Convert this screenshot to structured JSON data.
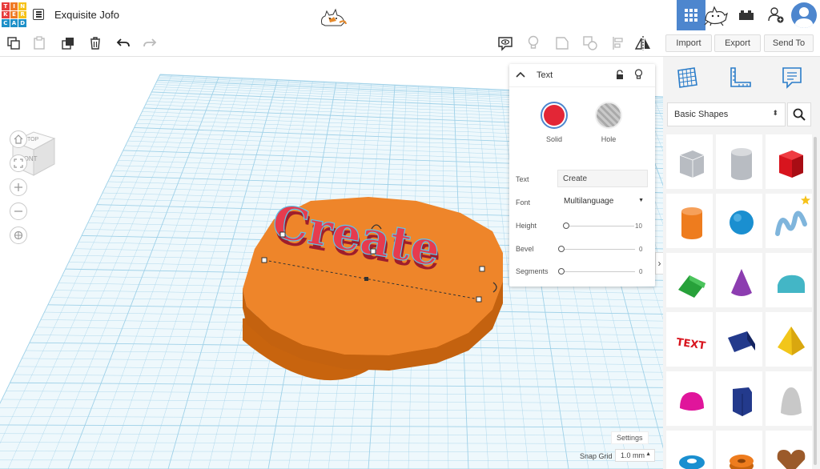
{
  "header": {
    "logo_letters": [
      "T",
      "I",
      "N",
      "K",
      "E",
      "R",
      "C",
      "A",
      "D"
    ],
    "design_title": "Exquisite Jofo"
  },
  "toolbar": {
    "buttons": [
      "copy",
      "paste",
      "duplicate",
      "delete",
      "undo",
      "redo",
      "note",
      "light-bulb",
      "group",
      "ungroup",
      "align",
      "mirror"
    ]
  },
  "actions": {
    "import_label": "Import",
    "export_label": "Export",
    "send_to_label": "Send To"
  },
  "view_cube": {
    "top_label": "TOP",
    "front_label": "FRONT"
  },
  "inspector": {
    "title": "Text",
    "solid_label": "Solid",
    "hole_label": "Hole",
    "solid_color": "#e32636",
    "text_label": "Text",
    "text_value": "Create",
    "font_label": "Font",
    "font_value": "Multilanguage",
    "height_label": "Height",
    "height_value": "10",
    "bevel_label": "Bevel",
    "bevel_value": "0",
    "segments_label": "Segments",
    "segments_value": "0"
  },
  "scene": {
    "text_object": "Create",
    "plate_color": "#f08a24",
    "text_color": "#e63b4e"
  },
  "workplane": {
    "settings_label": "Settings",
    "snap_grid_label": "Snap Grid",
    "snap_grid_value": "1.0 mm"
  },
  "shape_panel": {
    "category": "Basic Shapes",
    "shapes": [
      {
        "name": "box-hole",
        "color": "#b8bcc2"
      },
      {
        "name": "cylinder-hole",
        "color": "#b8bcc2"
      },
      {
        "name": "box",
        "color": "#d8141e"
      },
      {
        "name": "cylinder",
        "color": "#ee7c1e"
      },
      {
        "name": "sphere",
        "color": "#1a8fd0"
      },
      {
        "name": "scribble",
        "color": "#7fb5dc"
      },
      {
        "name": "roof",
        "color": "#27a13a"
      },
      {
        "name": "cone",
        "color": "#8c3db0"
      },
      {
        "name": "round-roof",
        "color": "#43b6c6"
      },
      {
        "name": "text",
        "color": "#d8141e"
      },
      {
        "name": "wedge",
        "color": "#233a8c"
      },
      {
        "name": "pyramid",
        "color": "#f2c61a"
      },
      {
        "name": "half-sphere",
        "color": "#e0159b"
      },
      {
        "name": "polygon",
        "color": "#233a8c"
      },
      {
        "name": "paraboloid",
        "color": "#c8c8c8"
      },
      {
        "name": "torus",
        "color": "#1a8fd0"
      },
      {
        "name": "tube",
        "color": "#ee7c1e"
      },
      {
        "name": "heart",
        "color": "#9b5a2a"
      }
    ]
  },
  "colors": {
    "accent": "#4d86ce",
    "grid": "#bfe1f0"
  }
}
